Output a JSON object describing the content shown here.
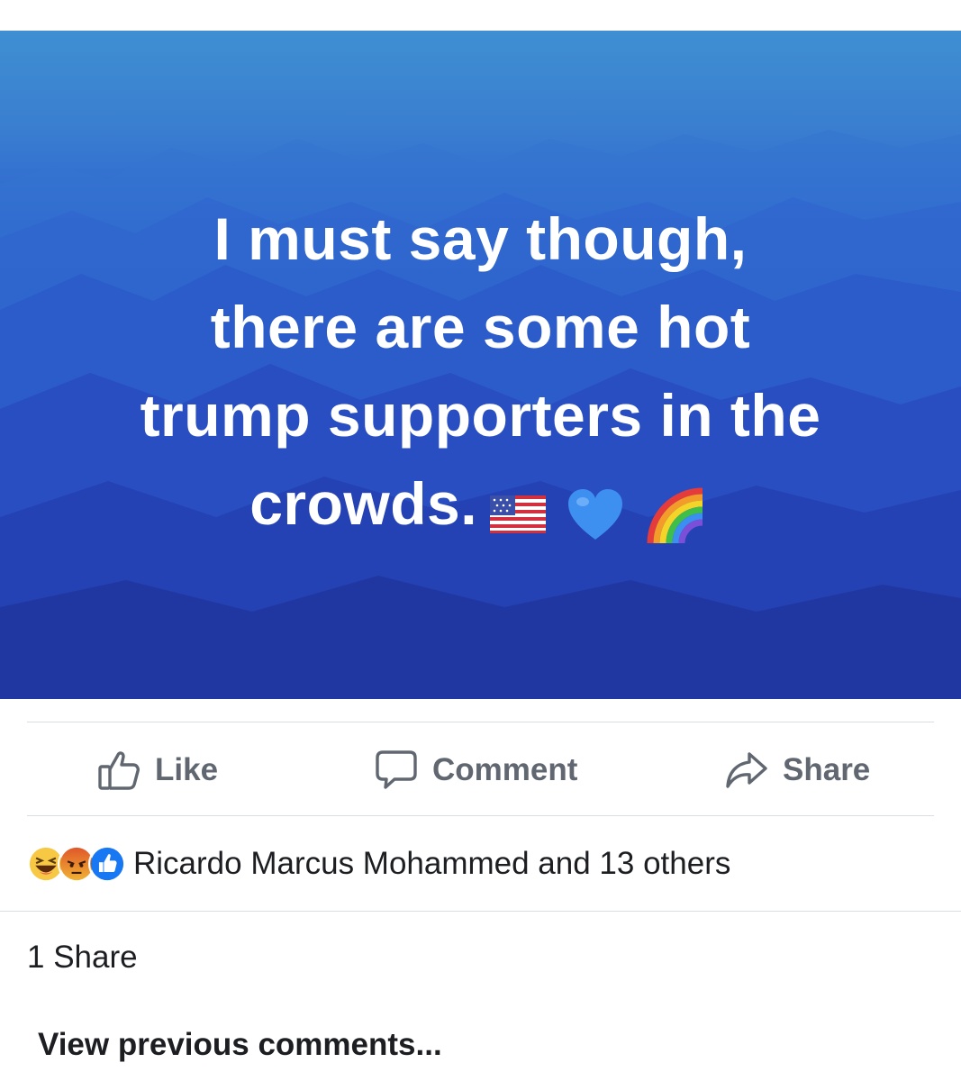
{
  "post": {
    "image_text_lines": [
      "I must say though,",
      "there are some hot",
      "trump supporters in the",
      "crowds."
    ],
    "image_emojis": [
      "us-flag-emoji",
      "blue-heart-emoji",
      "rainbow-emoji"
    ],
    "colors": {
      "background_top": "#3f8fd2",
      "background_bottom": "#2136a0",
      "text": "#ffffff"
    }
  },
  "actions": {
    "like_label": "Like",
    "comment_label": "Comment",
    "share_label": "Share",
    "icons": [
      "thumbs-up-icon",
      "comment-bubble-icon",
      "share-arrow-icon"
    ],
    "color": "#606770"
  },
  "reactions": {
    "types": [
      "haha-reaction-icon",
      "angry-reaction-icon",
      "like-reaction-icon"
    ],
    "summary": "Ricardo Marcus Mohammed and 13 others"
  },
  "shares": {
    "text": "1 Share"
  },
  "comments": {
    "view_previous": "View previous comments..."
  }
}
